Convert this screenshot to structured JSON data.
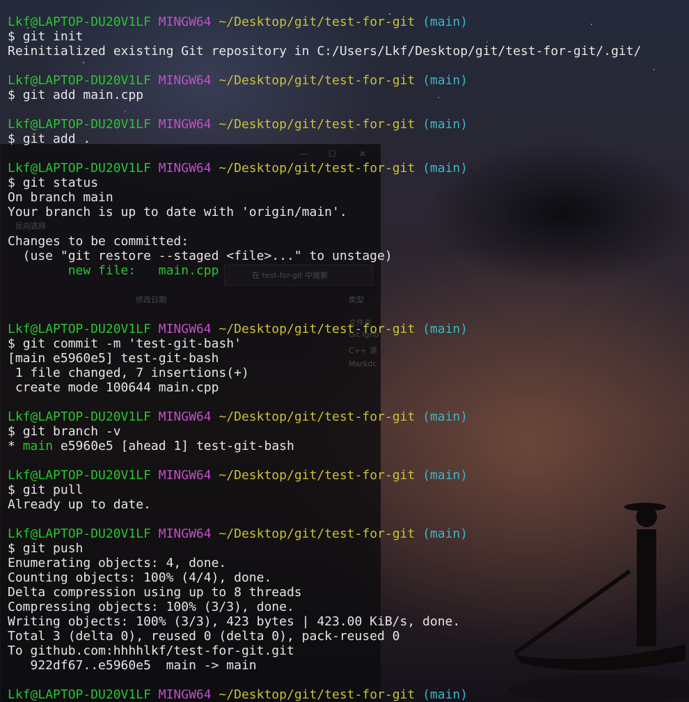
{
  "prompt": {
    "user_host": "Lkf@LAPTOP-DU20V1LF",
    "shell": "MINGW64",
    "path": "~/Desktop/git/test-for-git",
    "branch": "(main)",
    "symbol": "$"
  },
  "session": [
    {
      "command": "git init",
      "output": [
        "Reinitialized existing Git repository in C:/Users/Lkf/Desktop/git/test-for-git/.git/"
      ]
    },
    {
      "command": "git add main.cpp",
      "output": []
    },
    {
      "command": "git add .",
      "output": []
    },
    {
      "command": "git status",
      "output": [
        "On branch main",
        "Your branch is up to date with 'origin/main'.",
        "",
        "Changes to be committed:",
        "  (use \"git restore --staged <file>...\" to unstage)",
        "        new file:   main.cpp",
        "",
        ""
      ]
    },
    {
      "command": "git commit -m 'test-git-bash'",
      "output": [
        "[main e5960e5] test-git-bash",
        " 1 file changed, 7 insertions(+)",
        " create mode 100644 main.cpp"
      ]
    },
    {
      "command": "git branch -v",
      "output": [
        "* main e5960e5 [ahead 1] test-git-bash"
      ]
    },
    {
      "command": "git pull",
      "output": [
        "Already up to date."
      ]
    },
    {
      "command": "git push",
      "output": [
        "Enumerating objects: 4, done.",
        "Counting objects: 100% (4/4), done.",
        "Delta compression using up to 8 threads",
        "Compressing objects: 100% (3/3), done.",
        "Writing objects: 100% (3/3), 423 bytes | 423.00 KiB/s, done.",
        "Total 3 (delta 0), reused 0 (delta 0), pack-reused 0",
        "To github.com:hhhhlkf/test-for-git.git",
        "   922df67..e5960e5  main -> main"
      ]
    }
  ],
  "background_window": {
    "labels": [
      "反向选择",
      "修改日期",
      "类型",
      "在 test-for-git 中搜索",
      "文件夹",
      "Git Igno",
      "C++ 源",
      "Markdc"
    ]
  },
  "colors": {
    "user_host": "#29c52f",
    "shell": "#c44ec7",
    "path": "#c8c238",
    "branch": "#3bb6c8",
    "text": "#e6e6e6",
    "staged_file": "#29c52f"
  },
  "icons": [
    "cursor-icon"
  ]
}
